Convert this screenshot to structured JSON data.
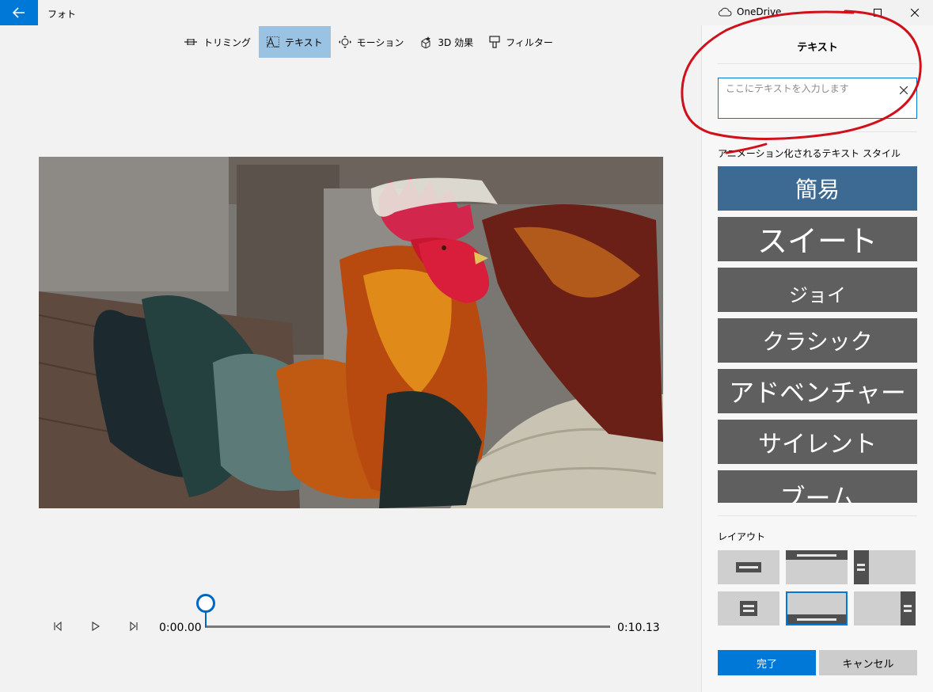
{
  "titlebar": {
    "app_name": "フォト",
    "cloud_label": "OneDrive"
  },
  "toolbar": {
    "tabs": [
      {
        "label": "トリミング",
        "icon": "trim-icon"
      },
      {
        "label": "テキスト",
        "icon": "text-icon",
        "active": true
      },
      {
        "label": "モーション",
        "icon": "motion-icon"
      },
      {
        "label": "3D 効果",
        "icon": "3d-effects-icon"
      },
      {
        "label": "フィルター",
        "icon": "filter-icon"
      }
    ]
  },
  "playback": {
    "current_time": "0:00.00",
    "end_time": "0:10.13",
    "progress": 0.0
  },
  "panel": {
    "title": "テキスト",
    "text_input": {
      "placeholder": "ここにテキストを入力します",
      "value": ""
    },
    "styles_label": "アニメーション化されるテキスト スタイル",
    "styles": [
      "簡易",
      "スイート",
      "ジョイ",
      "クラシック",
      "アドベンチャー",
      "サイレント",
      "ブーム"
    ],
    "selected_style": "簡易",
    "layout_label": "レイアウト",
    "layouts": [
      "center-bar",
      "top-bar",
      "left-bar",
      "center-box",
      "bottom-bar",
      "right-bar"
    ],
    "selected_layout": "bottom-bar",
    "done_label": "完了",
    "cancel_label": "キャンセル"
  },
  "colors": {
    "accent": "#0078d7",
    "selected_style": "#3c6a93",
    "style_tile": "#5f5f5f",
    "annotation": "#d0101a"
  }
}
